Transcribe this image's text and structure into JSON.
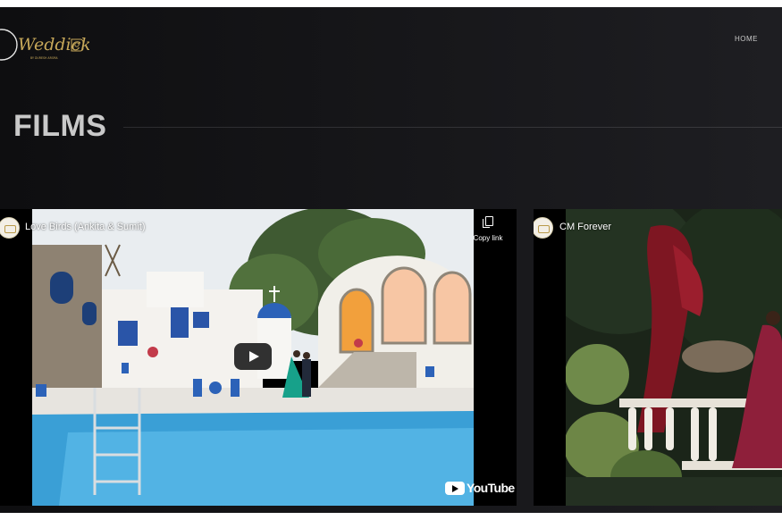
{
  "header": {
    "brand": "Weddicks",
    "brand_tagline": "BY DURESH ARORA",
    "nav": [
      {
        "label": "HOME"
      }
    ]
  },
  "page": {
    "title": "FILMS"
  },
  "videos": [
    {
      "title": "Love Birds (Ankita & Sumit)",
      "copy_link_label": "Copy link",
      "platform": "YouTube"
    },
    {
      "title": "CM Forever"
    }
  ],
  "icons": {
    "copy": "copy-icon",
    "play": "play-icon",
    "youtube": "youtube-icon"
  },
  "colors": {
    "background": "#121214",
    "title_text": "#c9c9c9",
    "logo_gold": "#c8a95a",
    "youtube_play_bg": "#212121"
  }
}
